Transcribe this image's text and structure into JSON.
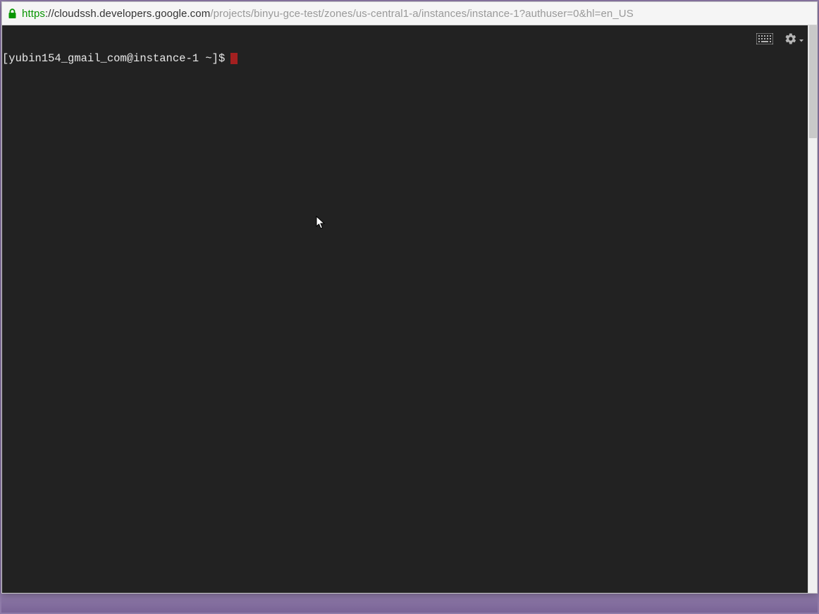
{
  "address_bar": {
    "scheme": "https",
    "host": "://cloudssh.developers.google.com",
    "path": "/projects/binyu-gce-test/zones/us-central1-a/instances/instance-1?authuser=0&hl=en_US"
  },
  "terminal": {
    "prompt": "[yubin154_gmail_com@instance-1 ~]$"
  },
  "controls": {
    "keyboard_label": "keyboard",
    "settings_label": "settings"
  }
}
